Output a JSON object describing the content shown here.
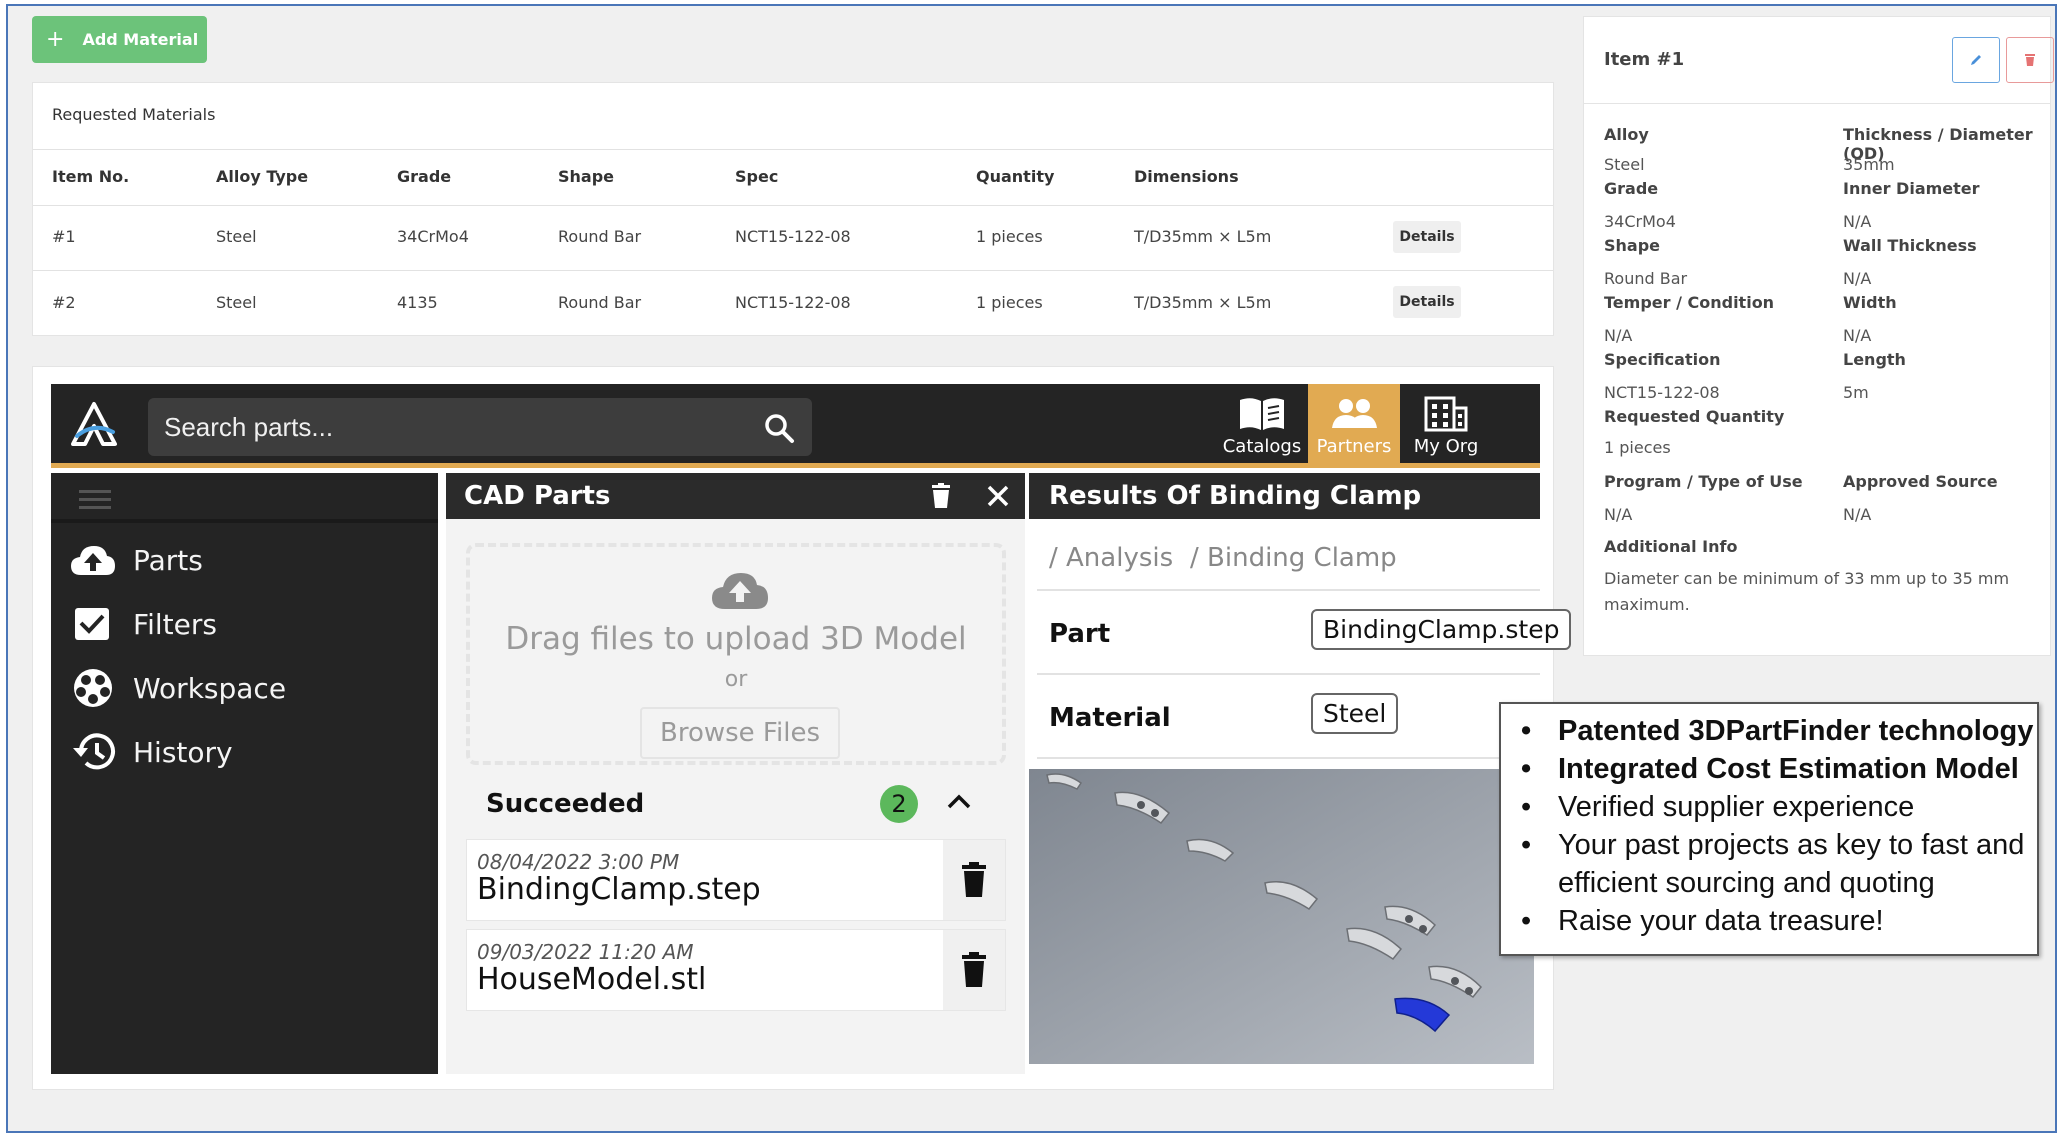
{
  "toolbar": {
    "add_material_label": "Add Material",
    "plus": "+"
  },
  "requested": {
    "title": "Requested Materials",
    "columns": [
      "Item No.",
      "Alloy Type",
      "Grade",
      "Shape",
      "Spec",
      "Quantity",
      "Dimensions"
    ],
    "rows": [
      {
        "item": "#1",
        "alloy": "Steel",
        "grade": "34CrMo4",
        "shape": "Round Bar",
        "spec": "NCT15-122-08",
        "qty": "1 pieces",
        "dims": "T/D35mm × L5m",
        "action": "Details"
      },
      {
        "item": "#2",
        "alloy": "Steel",
        "grade": "4135",
        "shape": "Round Bar",
        "spec": "NCT15-122-08",
        "qty": "1 pieces",
        "dims": "T/D35mm × L5m",
        "action": "Details"
      }
    ]
  },
  "cad": {
    "search_placeholder": "Search parts...",
    "nav": [
      {
        "label": "Catalogs",
        "icon": "book-icon"
      },
      {
        "label": "Partners",
        "icon": "people-icon"
      },
      {
        "label": "My Org",
        "icon": "building-icon"
      }
    ],
    "sidebar": [
      {
        "label": "Parts",
        "icon": "cloud-upload-icon"
      },
      {
        "label": "Filters",
        "icon": "checkbox-icon"
      },
      {
        "label": "Workspace",
        "icon": "workspace-icon"
      },
      {
        "label": "History",
        "icon": "history-icon"
      }
    ],
    "parts_panel": {
      "title": "CAD Parts",
      "drop_text": "Drag files to upload 3D Model",
      "or_text": "or",
      "browse_label": "Browse Files",
      "succeeded_label": "Succeeded",
      "succeeded_count": "2",
      "files": [
        {
          "date": "08/04/2022 3:00 PM",
          "name": "BindingClamp.step"
        },
        {
          "date": "09/03/2022 11:20 AM",
          "name": "HouseModel.stl"
        }
      ]
    },
    "results_panel": {
      "title": "Results Of Binding Clamp",
      "breadcrumb_1": "/ Analysis",
      "breadcrumb_2": "/ Binding Clamp",
      "part_label": "Part",
      "part_value": "BindingClamp.step",
      "material_label": "Material",
      "material_value": "Steel"
    }
  },
  "item": {
    "title": "Item #1",
    "left": [
      {
        "label": "Alloy",
        "value": "Steel"
      },
      {
        "label": "Grade",
        "value": "34CrMo4"
      },
      {
        "label": "Shape",
        "value": "Round Bar"
      },
      {
        "label": "Temper / Condition",
        "value": "N/A"
      },
      {
        "label": "Specification",
        "value": "NCT15-122-08"
      },
      {
        "label": "Requested Quantity",
        "value": "1 pieces"
      },
      {
        "label": "Program / Type of Use",
        "value": "N/A"
      }
    ],
    "right": [
      {
        "label": "Thickness / Diameter (OD)",
        "value": "35mm"
      },
      {
        "label": "Inner Diameter",
        "value": "N/A"
      },
      {
        "label": "Wall Thickness",
        "value": "N/A"
      },
      {
        "label": "Width",
        "value": "N/A"
      },
      {
        "label": "Length",
        "value": "5m"
      },
      {
        "label": "Approved Source",
        "value": "N/A"
      }
    ],
    "additional_label": "Additional Info",
    "additional_line1": "Diameter can be minimum of 33 mm up to 35 mm",
    "additional_line2": "maximum."
  },
  "callout": {
    "bullets": [
      "Patented 3DPartFinder technology",
      "Integrated Cost Estimation Model",
      "Verified supplier experience",
      "Your past projects as key to fast and",
      "efficient sourcing and quoting",
      "Raise your data treasure!"
    ]
  },
  "colors": {
    "accent_gold": "#e1aa52",
    "add_green": "#6cc37a",
    "dark": "#242424",
    "badge_green": "#5cb85c"
  }
}
